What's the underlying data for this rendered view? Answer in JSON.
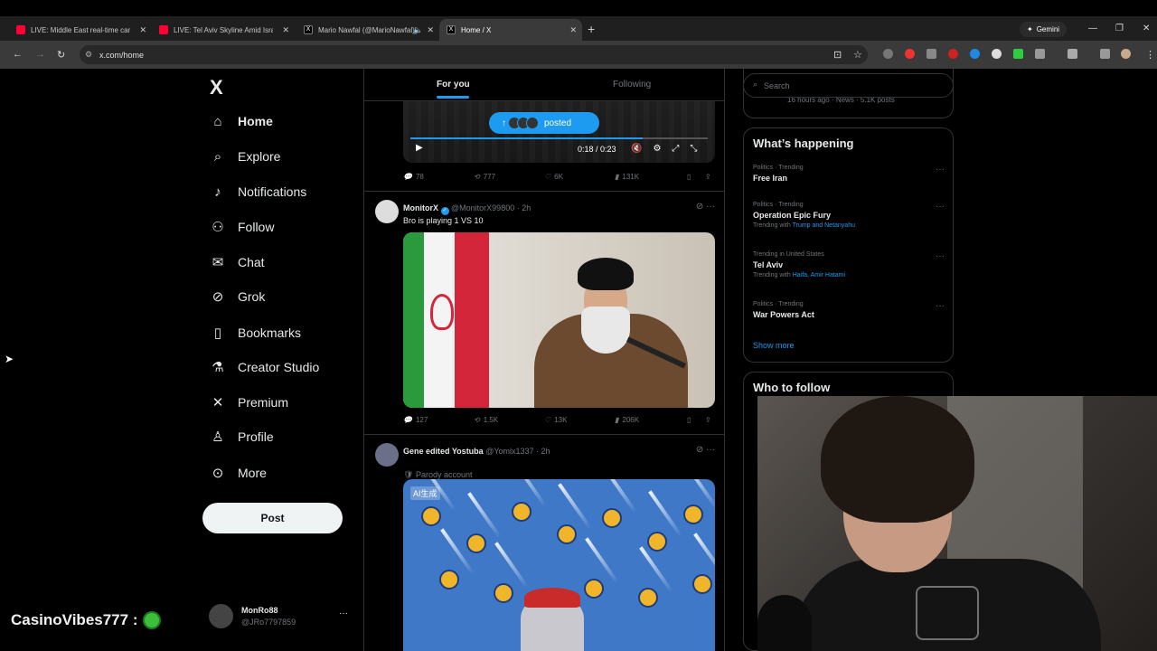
{
  "browser": {
    "tabs": [
      {
        "title": "LIVE: Middle East real-time cam",
        "type": "yt"
      },
      {
        "title": "LIVE: Tel Aviv Skyline Amid Israel",
        "type": "yt"
      },
      {
        "title": "Mario Nawfal (@MarioNawfal)",
        "type": "x"
      },
      {
        "title": "Home / X",
        "type": "x"
      }
    ],
    "gemini_label": "Gemini",
    "url": "x.com/home"
  },
  "nav": {
    "logo": "X",
    "items": [
      {
        "label": "Home",
        "icon": "home-icon"
      },
      {
        "label": "Explore",
        "icon": "search-icon"
      },
      {
        "label": "Notifications",
        "icon": "bell-icon"
      },
      {
        "label": "Follow",
        "icon": "add-person-icon"
      },
      {
        "label": "Chat",
        "icon": "mail-icon"
      },
      {
        "label": "Grok",
        "icon": "grok-icon"
      },
      {
        "label": "Bookmarks",
        "icon": "bookmark-icon"
      },
      {
        "label": "Creator Studio",
        "icon": "flask-icon"
      },
      {
        "label": "Premium",
        "icon": "x-icon"
      },
      {
        "label": "Profile",
        "icon": "person-icon"
      },
      {
        "label": "More",
        "icon": "more-circle-icon"
      }
    ],
    "post_label": "Post",
    "account": {
      "name": "MonRo88",
      "handle": "@JRo7797859"
    }
  },
  "feed": {
    "tabs": {
      "for_you": "For you",
      "following": "Following"
    },
    "posted_pill": "posted",
    "video": {
      "time": "0:18 / 0:23",
      "progress": 0.78
    },
    "post0_actions": {
      "replies": "78",
      "reposts": "777",
      "likes": "6K",
      "views": "131K"
    },
    "post1": {
      "name": "MonitorX",
      "handle": "@MonitorX99800 · 2h",
      "text": "Bro is playing 1 VS 10",
      "actions": {
        "replies": "127",
        "reposts": "1.5K",
        "likes": "13K",
        "views": "206K"
      }
    },
    "post2": {
      "name": "Gene edited Yostuba",
      "handle": "@Yomlx1337 · 2h",
      "label": "Parody account",
      "image_tag": "AI生成"
    }
  },
  "right": {
    "search_placeholder": "Search",
    "prev_meta": "16 hours ago · News · 5.1K posts",
    "whats_happening": "What’s happening",
    "trends": [
      {
        "context": "Politics · Trending",
        "title": "Free Iran",
        "with_label": "",
        "with": ""
      },
      {
        "context": "Politics · Trending",
        "title": "Operation Epic Fury",
        "with_label": "Trending with",
        "with": "Trump and Netanyahu"
      },
      {
        "context": "Trending in United States",
        "title": "Tel Aviv",
        "with_label": "Trending with",
        "with": "Haifa, Amir Hatami"
      },
      {
        "context": "Politics · Trending",
        "title": "War Powers Act",
        "with_label": "",
        "with": ""
      }
    ],
    "show_more": "Show more",
    "who_to_follow": "Who to follow"
  },
  "overlay": {
    "chat_text": "CasinoVibes777 :"
  }
}
